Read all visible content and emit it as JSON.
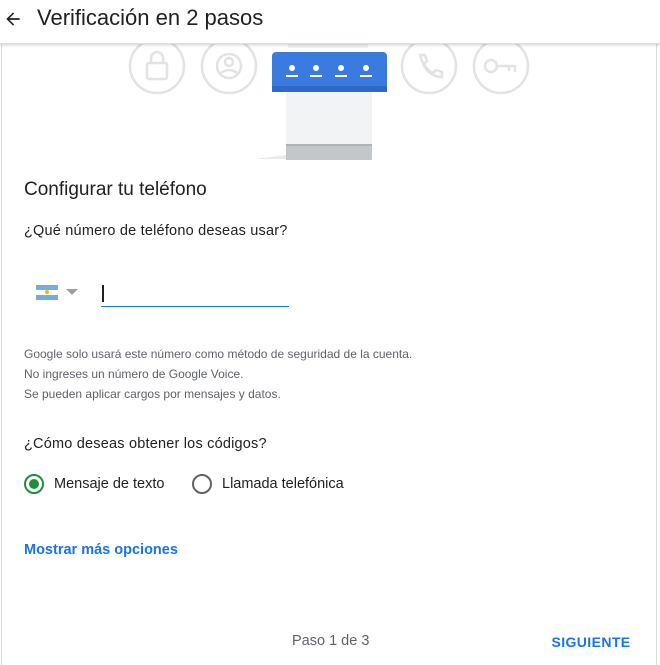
{
  "header": {
    "title": "Verificación en 2 pasos",
    "back_icon": "arrow-back-icon"
  },
  "illustration": {
    "icons": [
      "lock-icon",
      "account-icon",
      "phone-icon",
      "key-icon"
    ],
    "code_card_icon": "password-dots-icon",
    "accent_color": "#3b7be0"
  },
  "form": {
    "section_title": "Configurar tu teléfono",
    "phone_question": "¿Qué número de teléfono deseas usar?",
    "country_flag": "argentina-flag-icon",
    "phone_value": "",
    "phone_placeholder": "",
    "help_lines": [
      "Google solo usará este número como método de seguridad de la cuenta.",
      "No ingreses un número de Google Voice.",
      "Se pueden aplicar cargos por mensajes y datos."
    ],
    "method_question": "¿Cómo deseas obtener los códigos?",
    "methods": [
      {
        "label": "Mensaje de texto",
        "selected": true
      },
      {
        "label": "Llamada telefónica",
        "selected": false
      }
    ],
    "more_options": "Mostrar más opciones"
  },
  "footer": {
    "step": "Paso 1 de 3",
    "next_label": "SIGUIENTE"
  },
  "colors": {
    "primary": "#1a73e8",
    "radio_selected": "#1e8e3e",
    "muted_text": "#5f6368"
  }
}
